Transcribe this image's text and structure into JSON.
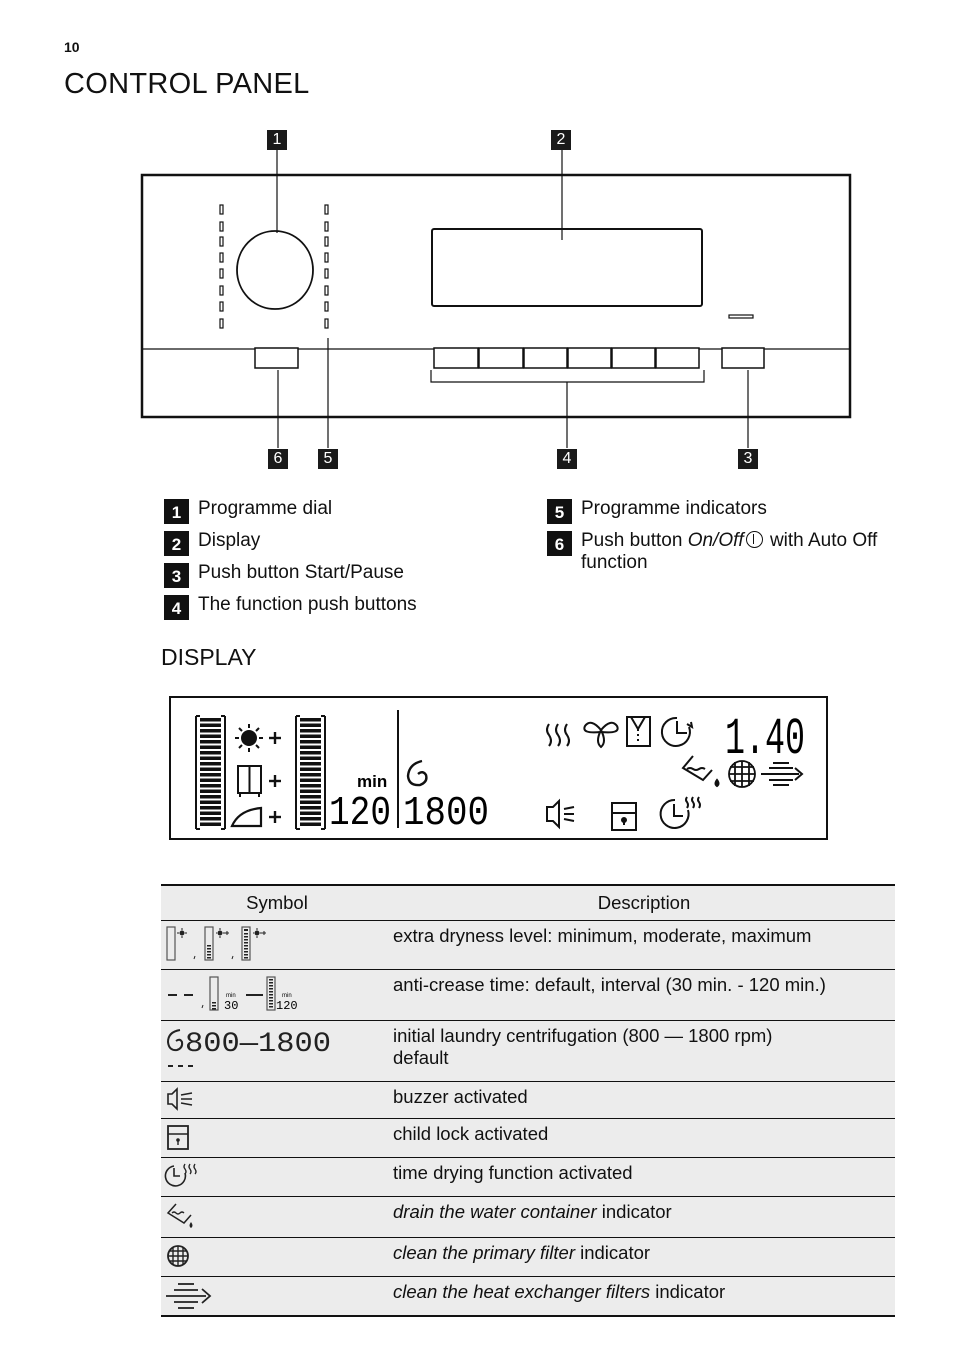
{
  "page": {
    "number": "10",
    "title": "CONTROL PANEL",
    "display_section_title": "DISPLAY"
  },
  "panel_diagram": {
    "callouts": [
      "1",
      "2",
      "3",
      "4",
      "5",
      "6"
    ]
  },
  "legend": {
    "items": [
      {
        "num": "1",
        "text": "Programme dial"
      },
      {
        "num": "2",
        "text": "Display"
      },
      {
        "num": "3",
        "text": "Push button Start/Pause"
      },
      {
        "num": "4",
        "text": "The function push buttons"
      },
      {
        "num": "5",
        "text": "Programme indicators"
      },
      {
        "num": "6",
        "pre": "Push button ",
        "italic": "On/Off",
        "post": " with Auto Off function",
        "icon": "power-icon"
      }
    ]
  },
  "display": {
    "min_label": "min",
    "time_digits": "120",
    "spin_digits": "1800",
    "remaining_time": "1.40"
  },
  "table": {
    "headers": {
      "symbol": "Symbol",
      "description": "Description"
    },
    "rows": [
      {
        "icon": "dryness-level-bars-icon",
        "description": "extra dryness level: minimum, moderate, maximum"
      },
      {
        "icon": "anti-crease-bars-icon",
        "description": "anti-crease time: default, interval (30 min. - 120 min.)",
        "symbol_text": {
          "dash": "- -",
          "min_label": "min",
          "v1": "30",
          "v2": "120"
        }
      },
      {
        "icon": "spin-speed-icon",
        "description_line1": "initial laundry centrifugation (800 — 1800 rpm)",
        "description_line2": "default",
        "symbol_text": {
          "range": "800—1800",
          "default": "- - -"
        }
      },
      {
        "icon": "buzzer-icon",
        "description": "buzzer activated"
      },
      {
        "icon": "child-lock-icon",
        "description": "child lock activated"
      },
      {
        "icon": "time-drying-icon",
        "description": "time drying function activated"
      },
      {
        "icon": "drain-container-icon",
        "italic": "drain the water container",
        "post": " indicator"
      },
      {
        "icon": "primary-filter-icon",
        "italic": "clean the primary filter",
        "post": " indicator"
      },
      {
        "icon": "heat-exchanger-filter-icon",
        "italic": "clean the heat exchanger filters",
        "post": " indicator"
      }
    ]
  }
}
